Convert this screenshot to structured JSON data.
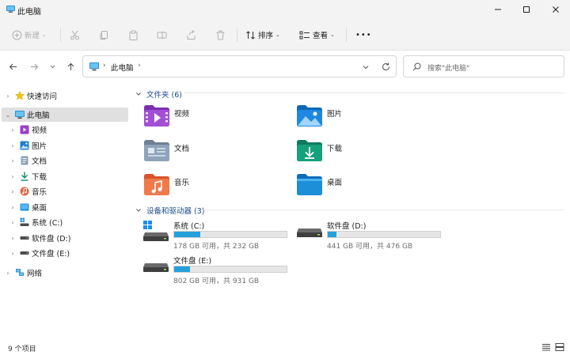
{
  "window": {
    "title": "此电脑",
    "minimize": "minimize",
    "maximize": "maximize",
    "close": "close"
  },
  "toolbar": {
    "new_label": "新建",
    "sort_label": "排序",
    "view_label": "查看",
    "more_label": "•••"
  },
  "address": {
    "crumb": "此电脑",
    "search_placeholder": "搜索\"此电脑\""
  },
  "sidebar": {
    "quick_access": "快速访问",
    "this_pc": "此电脑",
    "items": [
      {
        "label": "视频",
        "icon": "video-folder-icon"
      },
      {
        "label": "图片",
        "icon": "pictures-folder-icon"
      },
      {
        "label": "文档",
        "icon": "documents-folder-icon"
      },
      {
        "label": "下载",
        "icon": "downloads-folder-icon"
      },
      {
        "label": "音乐",
        "icon": "music-folder-icon"
      },
      {
        "label": "桌面",
        "icon": "desktop-folder-icon"
      },
      {
        "label": "系统 (C:)",
        "icon": "system-drive-icon"
      },
      {
        "label": "软件盘 (D:)",
        "icon": "drive-icon"
      },
      {
        "label": "文件盘 (E:)",
        "icon": "drive-icon"
      }
    ],
    "network": "网络"
  },
  "content": {
    "folders_header": "文件夹 (6)",
    "folders": [
      {
        "label": "视频",
        "icon": "video-folder-icon"
      },
      {
        "label": "图片",
        "icon": "pictures-folder-icon"
      },
      {
        "label": "文档",
        "icon": "documents-folder-icon"
      },
      {
        "label": "下载",
        "icon": "downloads-folder-icon"
      },
      {
        "label": "音乐",
        "icon": "music-folder-icon"
      },
      {
        "label": "桌面",
        "icon": "desktop-folder-icon"
      }
    ],
    "drives_header": "设备和驱动器 (3)",
    "drives": [
      {
        "name": "系统 (C:)",
        "info": "178 GB 可用，共 232 GB",
        "used_fraction": 0.23
      },
      {
        "name": "软件盘 (D:)",
        "info": "441 GB 可用，共 476 GB",
        "used_fraction": 0.074
      },
      {
        "name": "文件盘 (E:)",
        "info": "802 GB 可用，共 931 GB",
        "used_fraction": 0.139
      }
    ]
  },
  "status": {
    "count": "9 个项目"
  },
  "colors": {
    "accent": "#26a0da",
    "section_header": "#1a4a8a",
    "selected_bg": "#e0e0e0"
  }
}
